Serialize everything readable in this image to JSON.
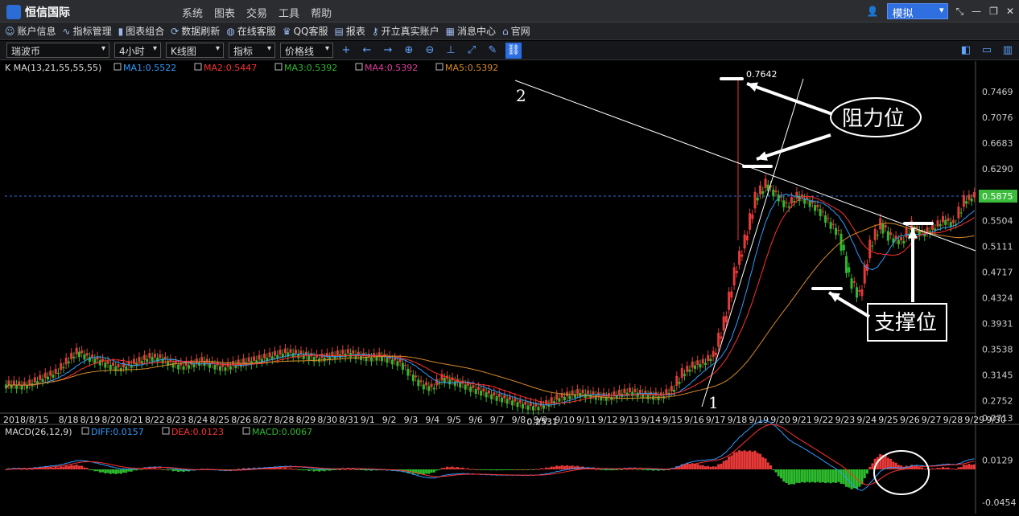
{
  "titlebar": {
    "app_name": "恒信国际",
    "menus": [
      "系统",
      "图表",
      "交易",
      "工具",
      "帮助"
    ],
    "mode": "模拟"
  },
  "toolbar": {
    "items": [
      {
        "icon": "person-icon",
        "label": "账户信息"
      },
      {
        "icon": "trend-icon",
        "label": "指标管理"
      },
      {
        "icon": "bar-icon",
        "label": "图表组合"
      },
      {
        "icon": "refresh-icon",
        "label": "数据刷新"
      },
      {
        "icon": "globe-icon",
        "label": "在线客服"
      },
      {
        "icon": "qq-icon",
        "label": "QQ客服"
      },
      {
        "icon": "report-icon",
        "label": "报表"
      },
      {
        "icon": "key-icon",
        "label": "开立真实账户"
      },
      {
        "icon": "message-icon",
        "label": "消息中心"
      },
      {
        "icon": "home-icon",
        "label": "官网"
      }
    ]
  },
  "ctrl": {
    "symbol": "瑞波币",
    "period": "4小时",
    "chart_type": "K线图",
    "indicator": "指标",
    "line_type": "价格线"
  },
  "chart_data": [
    {
      "type": "candlestick",
      "legend_prefix": "K  MA(13,21,55,55,55)",
      "ma": [
        {
          "name": "MA1",
          "value": "0.5522",
          "color": "#2f9bff"
        },
        {
          "name": "MA2",
          "value": "0.5447",
          "color": "#ff3030"
        },
        {
          "name": "MA3",
          "value": "0.5392",
          "color": "#2dbb2d"
        },
        {
          "name": "MA4",
          "value": "0.5392",
          "color": "#e03ca0"
        },
        {
          "name": "MA5",
          "value": "0.5392",
          "color": "#d88a2a"
        }
      ],
      "yticks": [
        "0.7469",
        "0.7076",
        "0.6683",
        "0.6290",
        "0.5875",
        "0.5504",
        "0.5111",
        "0.4717",
        "0.4324",
        "0.3931",
        "0.3538",
        "0.3145",
        "0.2752"
      ],
      "ylim": [
        0.2576,
        0.7764
      ],
      "current_price": "0.5875",
      "high_label": "0.7642",
      "low_label": "0.2531",
      "xlabels": [
        "2018/8/15",
        "8/18",
        "8/19",
        "8/20",
        "8/21",
        "8/22",
        "8/23",
        "8/24",
        "8/25",
        "8/26",
        "8/27",
        "8/28",
        "8/29",
        "8/30",
        "8/31",
        "9/1",
        "9/2",
        "9/3",
        "9/4",
        "9/5",
        "9/6",
        "9/7",
        "9/8",
        "9/9",
        "9/10",
        "9/11",
        "9/12",
        "9/13",
        "9/14",
        "9/15",
        "9/16",
        "9/17",
        "9/18",
        "9/19",
        "9/20",
        "9/21",
        "9/22",
        "9/23",
        "9/24",
        "9/25",
        "9/26",
        "9/27",
        "9/28",
        "9/29",
        "9/30"
      ],
      "closes": [
        0.3,
        0.298,
        0.305,
        0.312,
        0.318,
        0.335,
        0.35,
        0.342,
        0.337,
        0.33,
        0.325,
        0.33,
        0.336,
        0.342,
        0.34,
        0.333,
        0.328,
        0.331,
        0.336,
        0.33,
        0.326,
        0.33,
        0.334,
        0.337,
        0.341,
        0.345,
        0.349,
        0.347,
        0.344,
        0.34,
        0.342,
        0.346,
        0.348,
        0.344,
        0.341,
        0.343,
        0.338,
        0.333,
        0.315,
        0.3,
        0.295,
        0.31,
        0.305,
        0.3,
        0.293,
        0.288,
        0.282,
        0.278,
        0.273,
        0.268,
        0.266,
        0.27,
        0.279,
        0.283,
        0.287,
        0.285,
        0.282,
        0.281,
        0.286,
        0.289,
        0.286,
        0.283,
        0.282,
        0.292,
        0.316,
        0.329,
        0.333,
        0.345,
        0.395,
        0.47,
        0.52,
        0.585,
        0.605,
        0.59,
        0.572,
        0.588,
        0.58,
        0.568,
        0.548,
        0.53,
        0.462,
        0.435,
        0.512,
        0.545,
        0.523,
        0.519,
        0.541,
        0.53,
        0.538,
        0.551,
        0.545,
        0.58,
        0.5875
      ],
      "annotations": {
        "resistance": "阻力位",
        "support": "支撑位",
        "line1": "1",
        "line2": "2"
      }
    },
    {
      "type": "macd",
      "legend_prefix": "MACD(26,12,9)",
      "values": [
        {
          "name": "DIFF",
          "value": "0.0157",
          "color": "#2f9bff"
        },
        {
          "name": "DEA",
          "value": "0.0123",
          "color": "#ff3030"
        },
        {
          "name": "MACD",
          "value": "0.0067",
          "color": "#2dbb2d"
        }
      ],
      "yticks": [
        "0.0713",
        "0.0129",
        "-0.0454"
      ]
    }
  ],
  "colors": {
    "up": "#e83838",
    "down": "#2dbb2d",
    "grid": "#333333",
    "price_line": "#2f6fe0",
    "annot": "#ffffff"
  }
}
